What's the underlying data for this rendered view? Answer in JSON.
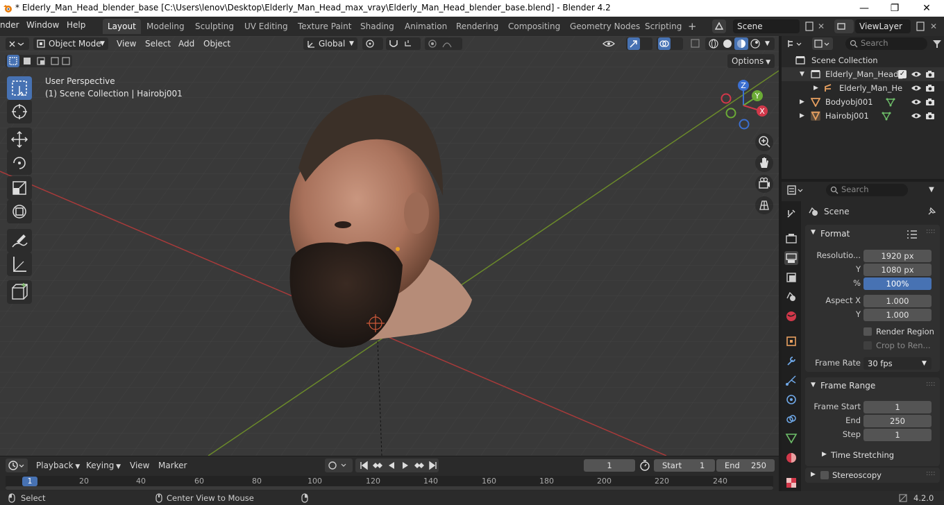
{
  "window": {
    "title": "* Elderly_Man_Head_blender_base [C:\\Users\\lenov\\Desktop\\Elderly_Man_Head_max_vray\\Elderly_Man_Head_blender_base.blend] - Blender 4.2",
    "minimize": "—",
    "maximize": "❐",
    "close": "✕"
  },
  "menubar": {
    "items": [
      "nder",
      "Window",
      "Help"
    ],
    "workspaces": [
      "Layout",
      "Modeling",
      "Sculpting",
      "UV Editing",
      "Texture Paint",
      "Shading",
      "Animation",
      "Rendering",
      "Compositing",
      "Geometry Nodes",
      "Scripting"
    ],
    "add_tab": "+",
    "scene": "Scene",
    "view_layer": "ViewLayer"
  },
  "viewport_header": {
    "mode": "Object Mode",
    "menus": [
      "View",
      "Select",
      "Add",
      "Object"
    ],
    "transform_orientation": "Global",
    "options": "Options"
  },
  "viewport": {
    "perspective": "User Perspective",
    "collection_info": "(1) Scene Collection | Hairobj001",
    "gizmo": {
      "z": "Z",
      "y": "Y",
      "x": "X"
    }
  },
  "outliner": {
    "search_placeholder": "Search",
    "root": "Scene Collection",
    "items": [
      {
        "label": "Elderly_Man_Head_",
        "kind": "collection"
      },
      {
        "label": "Elderly_Man_He",
        "kind": "armature"
      },
      {
        "label": "Bodyobj001",
        "kind": "mesh"
      },
      {
        "label": "Hairobj001",
        "kind": "mesh"
      }
    ]
  },
  "properties": {
    "search_placeholder": "Search",
    "context": "Scene",
    "format": {
      "header": "Format",
      "resolution_label": "Resolutio...",
      "res_x": "1920 px",
      "y_label": "Y",
      "res_y": "1080 px",
      "pct_label": "%",
      "pct": "100%",
      "aspect_label": "Aspect X",
      "aspect_x": "1.000",
      "aspect_y_label": "Y",
      "aspect_y": "1.000",
      "render_region": "Render Region",
      "crop": "Crop to Ren...",
      "frame_rate_label": "Frame Rate",
      "frame_rate": "30 fps"
    },
    "frame_range": {
      "header": "Frame Range",
      "start_label": "Frame Start",
      "start": "1",
      "end_label": "End",
      "end": "250",
      "step_label": "Step",
      "step": "1",
      "time_stretching": "Time Stretching"
    },
    "stereoscopy": "Stereoscopy"
  },
  "timeline": {
    "menus": [
      "Playback",
      "Keying",
      "View",
      "Marker"
    ],
    "current_frame": "1",
    "start_label": "Start",
    "start": "1",
    "end_label": "End",
    "end": "250",
    "ruler": [
      "1",
      "20",
      "40",
      "60",
      "80",
      "100",
      "120",
      "140",
      "160",
      "180",
      "200",
      "220",
      "240"
    ]
  },
  "statusbar": {
    "select": "Select",
    "center_view": "Center View to Mouse",
    "version": "4.2.0"
  }
}
